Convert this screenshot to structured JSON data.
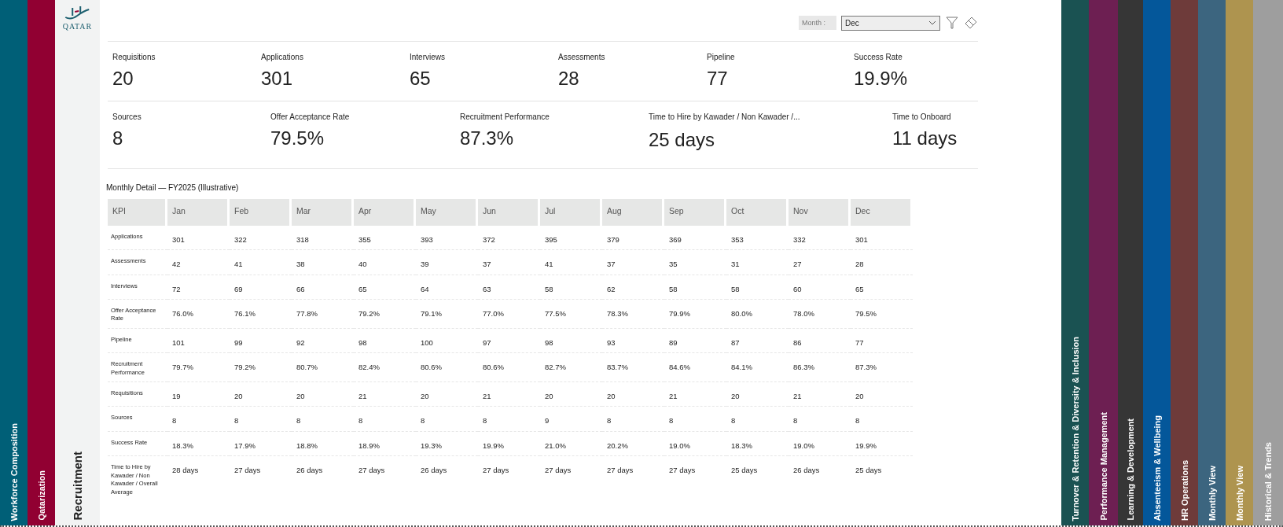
{
  "left_tabs": [
    {
      "label": "Workforce Composition",
      "color": "#005f77",
      "selected": false
    },
    {
      "label": "Qatarization",
      "color": "#910032",
      "selected": false
    },
    {
      "label": "Recruitment",
      "color": "#f2f3f3",
      "selected": true
    }
  ],
  "logo": {
    "text": "QATAR"
  },
  "filter": {
    "label": "Month :",
    "value": "Dec"
  },
  "kpi_row_1": [
    {
      "label": "Requisitions",
      "value": "20"
    },
    {
      "label": "Applications",
      "value": "301"
    },
    {
      "label": "Interviews",
      "value": "65"
    },
    {
      "label": "Assessments",
      "value": "28"
    },
    {
      "label": "Pipeline",
      "value": "77"
    },
    {
      "label": "Success Rate",
      "value": "19.9%"
    }
  ],
  "kpi_row_2": [
    {
      "label": "Sources",
      "value": "8"
    },
    {
      "label": "Offer Acceptance Rate",
      "value": "79.5%"
    },
    {
      "label": "Recruitment Performance",
      "value": "87.3%"
    },
    {
      "label": "Time to Hire by Kawader / Non Kawader /...",
      "value": "25 days"
    },
    {
      "label": "Time to Onboard",
      "value": "11 days"
    }
  ],
  "table": {
    "title": "Monthly Detail — FY2025 (Illustrative)",
    "columns": [
      "KPI",
      "Jan",
      "Feb",
      "Mar",
      "Apr",
      "May",
      "Jun",
      "Jul",
      "Aug",
      "Sep",
      "Oct",
      "Nov",
      "Dec"
    ],
    "rows": [
      [
        "Applications",
        "301",
        "322",
        "318",
        "355",
        "393",
        "372",
        "395",
        "379",
        "369",
        "353",
        "332",
        "301"
      ],
      [
        "Assessments",
        "42",
        "41",
        "38",
        "40",
        "39",
        "37",
        "41",
        "37",
        "35",
        "31",
        "27",
        "28"
      ],
      [
        "Interviews",
        "72",
        "69",
        "66",
        "65",
        "64",
        "63",
        "58",
        "62",
        "58",
        "58",
        "60",
        "65"
      ],
      [
        "Offer Acceptance Rate",
        "76.0%",
        "76.1%",
        "77.8%",
        "79.2%",
        "79.1%",
        "77.0%",
        "77.5%",
        "78.3%",
        "79.9%",
        "80.0%",
        "78.0%",
        "79.5%"
      ],
      [
        "Pipeline",
        "101",
        "99",
        "92",
        "98",
        "100",
        "97",
        "98",
        "93",
        "89",
        "87",
        "86",
        "77"
      ],
      [
        "Recruitment Performance",
        "79.7%",
        "79.2%",
        "80.7%",
        "82.4%",
        "80.6%",
        "80.6%",
        "82.7%",
        "83.7%",
        "84.6%",
        "84.1%",
        "86.3%",
        "87.3%"
      ],
      [
        "Requisitions",
        "19",
        "20",
        "20",
        "21",
        "20",
        "21",
        "20",
        "20",
        "21",
        "20",
        "21",
        "20"
      ],
      [
        "Sources",
        "8",
        "8",
        "8",
        "8",
        "8",
        "8",
        "9",
        "8",
        "8",
        "8",
        "8",
        "8"
      ],
      [
        "Success Rate",
        "18.3%",
        "17.9%",
        "18.8%",
        "18.9%",
        "19.3%",
        "19.9%",
        "21.0%",
        "20.2%",
        "19.0%",
        "18.3%",
        "19.0%",
        "19.9%"
      ],
      [
        "Time to Hire by Kawader / Non Kawader / Overall Average",
        "28 days",
        "27 days",
        "26 days",
        "27 days",
        "26 days",
        "27 days",
        "27 days",
        "27 days",
        "27 days",
        "25 days",
        "26 days",
        "25 days"
      ]
    ]
  },
  "right_tabs": [
    {
      "label": "Turnover & Retention & Diversity & Inclusion",
      "color": "#1a5252",
      "selected": false
    },
    {
      "label": "Performance Management",
      "color": "#6d1f52",
      "selected": false
    },
    {
      "label": "Learning & Development",
      "color": "#363636",
      "selected": false
    },
    {
      "label": "Absenteeism & Wellbeing",
      "color": "#04579a",
      "selected": false
    },
    {
      "label": "HR Operations",
      "color": "#6e3b3a",
      "selected": false
    },
    {
      "label": "Monthly View",
      "color": "#3c657f",
      "selected": false
    },
    {
      "label": "Monthly View",
      "color": "#ae944f",
      "selected": false
    },
    {
      "label": "Historical & Trends",
      "color": "#9e9e9e",
      "selected": false
    }
  ]
}
